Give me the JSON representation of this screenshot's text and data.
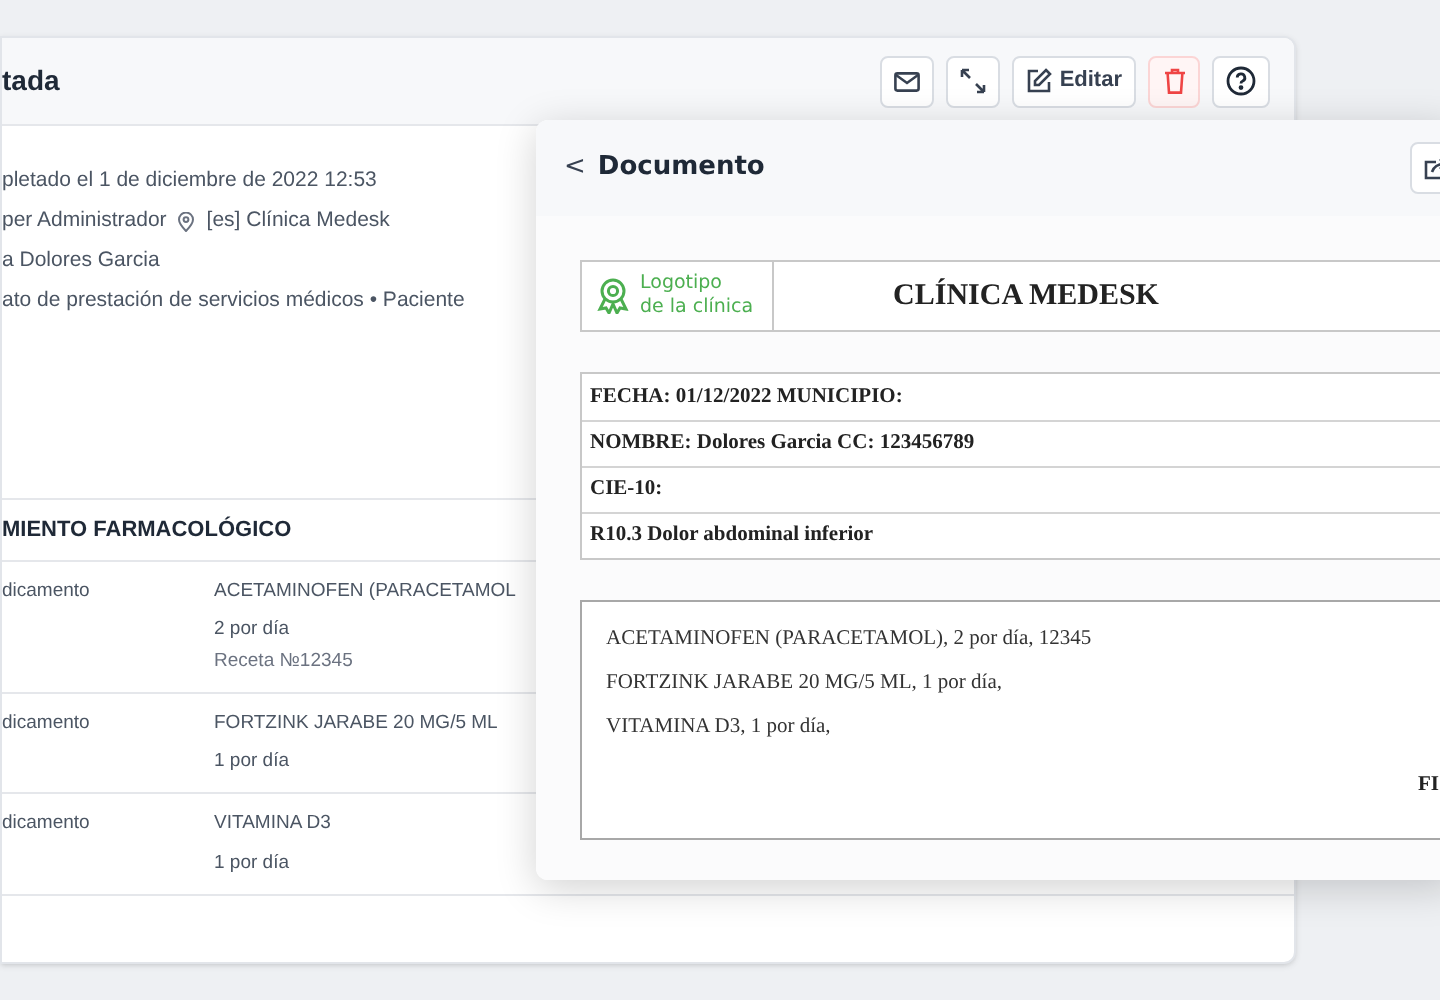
{
  "back_card": {
    "title": "tada",
    "toolbar": [
      {
        "kind": "mail"
      },
      {
        "kind": "expand"
      },
      {
        "kind": "edit",
        "label": "Editar"
      },
      {
        "kind": "delete"
      },
      {
        "kind": "help"
      }
    ],
    "info": [
      {
        "kind": "text",
        "text": "pletado el 1 de diciembre de 2022 12:53"
      },
      {
        "kind": "location",
        "text": "per Administrador",
        "extra": "[es] Clínica Medesk"
      },
      {
        "kind": "text",
        "text": "a Dolores Garcia"
      },
      {
        "kind": "text",
        "text": "ato de prestación de servicios médicos • Paciente"
      }
    ],
    "section_title": "MIENTO FARMACOLÓGICO",
    "rows": [
      {
        "label": "dicamento",
        "name": "ACETAMINOFEN (PARACETAMOL",
        "details": [
          "2 por día",
          "Receta №12345"
        ]
      },
      {
        "label": "dicamento",
        "name": "FORTZINK JARABE 20 MG/5 ML",
        "details": [
          "1 por día"
        ]
      },
      {
        "label": "dicamento",
        "name": "VITAMINA D3",
        "details": [
          "1 por día"
        ]
      }
    ]
  },
  "document": {
    "title": "Documento",
    "back": "<",
    "logo_text": [
      "Logotipo",
      "de la clínica"
    ],
    "clinic": "CLÍNICA MEDESK",
    "fields": [
      "FECHA: 01/12/2022 MUNICIPIO:",
      "NOMBRE: Dolores Garcia CC: 123456789",
      "CIE-10:",
      "R10.3 Dolor abdominal inferior"
    ],
    "prescriptions": [
      "ACETAMINOFEN (PARACETAMOL), 2 por día, 12345",
      "FORTZINK JARABE 20 MG/5 ML, 1 por día,",
      "VITAMINA D3, 1 por día,"
    ],
    "signature": "FI"
  }
}
